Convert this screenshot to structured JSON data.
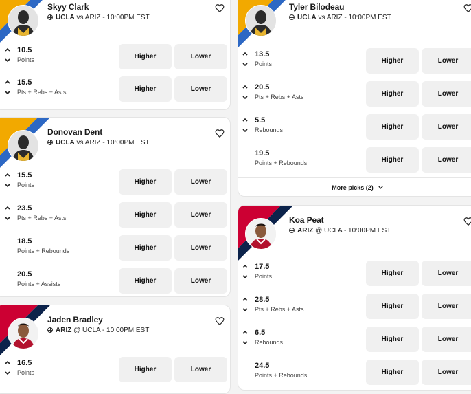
{
  "colors": {
    "ucla_gold": "#F2A900",
    "ucla_blue": "#2D68C4",
    "ariz_red": "#CC0033",
    "ariz_navy": "#0C234B",
    "button_bg": "#f0f0f0"
  },
  "cards": [
    {
      "player": "Skyy Clark",
      "team": "UCLA",
      "game_bold": "UCLA",
      "game_rest": " vs ARIZ - 10:00PM EST",
      "picks": [
        {
          "value": "10.5",
          "stat": "Points",
          "arrows": true
        },
        {
          "value": "15.5",
          "stat": "Pts + Rebs + Asts",
          "arrows": true
        }
      ]
    },
    {
      "player": "Donovan Dent",
      "team": "UCLA",
      "game_bold": "UCLA",
      "game_rest": " vs ARIZ - 10:00PM EST",
      "picks": [
        {
          "value": "15.5",
          "stat": "Points",
          "arrows": true
        },
        {
          "value": "23.5",
          "stat": "Pts + Rebs + Asts",
          "arrows": true
        },
        {
          "value": "18.5",
          "stat": "Points + Rebounds",
          "arrows": false
        },
        {
          "value": "20.5",
          "stat": "Points + Assists",
          "arrows": false
        }
      ]
    },
    {
      "player": "Jaden Bradley",
      "team": "ARIZ",
      "game_bold": "ARIZ",
      "game_rest": " @ UCLA - 10:00PM EST",
      "picks": [
        {
          "value": "16.5",
          "stat": "Points",
          "arrows": true
        }
      ]
    },
    {
      "player": "Tyler Bilodeau",
      "team": "UCLA",
      "game_bold": "UCLA",
      "game_rest": " vs ARIZ - 10:00PM EST",
      "picks": [
        {
          "value": "13.5",
          "stat": "Points",
          "arrows": true
        },
        {
          "value": "20.5",
          "stat": "Pts + Rebs + Asts",
          "arrows": true
        },
        {
          "value": "5.5",
          "stat": "Rebounds",
          "arrows": true
        },
        {
          "value": "19.5",
          "stat": "Points + Rebounds",
          "arrows": false
        }
      ],
      "more": "More picks (2)"
    },
    {
      "player": "Koa Peat",
      "team": "ARIZ",
      "game_bold": "ARIZ",
      "game_rest": " @ UCLA - 10:00PM EST",
      "picks": [
        {
          "value": "17.5",
          "stat": "Points",
          "arrows": true
        },
        {
          "value": "28.5",
          "stat": "Pts + Rebs + Asts",
          "arrows": true
        },
        {
          "value": "6.5",
          "stat": "Rebounds",
          "arrows": true
        },
        {
          "value": "24.5",
          "stat": "Points + Rebounds",
          "arrows": false
        }
      ]
    }
  ],
  "labels": {
    "higher": "Higher",
    "lower": "Lower"
  }
}
